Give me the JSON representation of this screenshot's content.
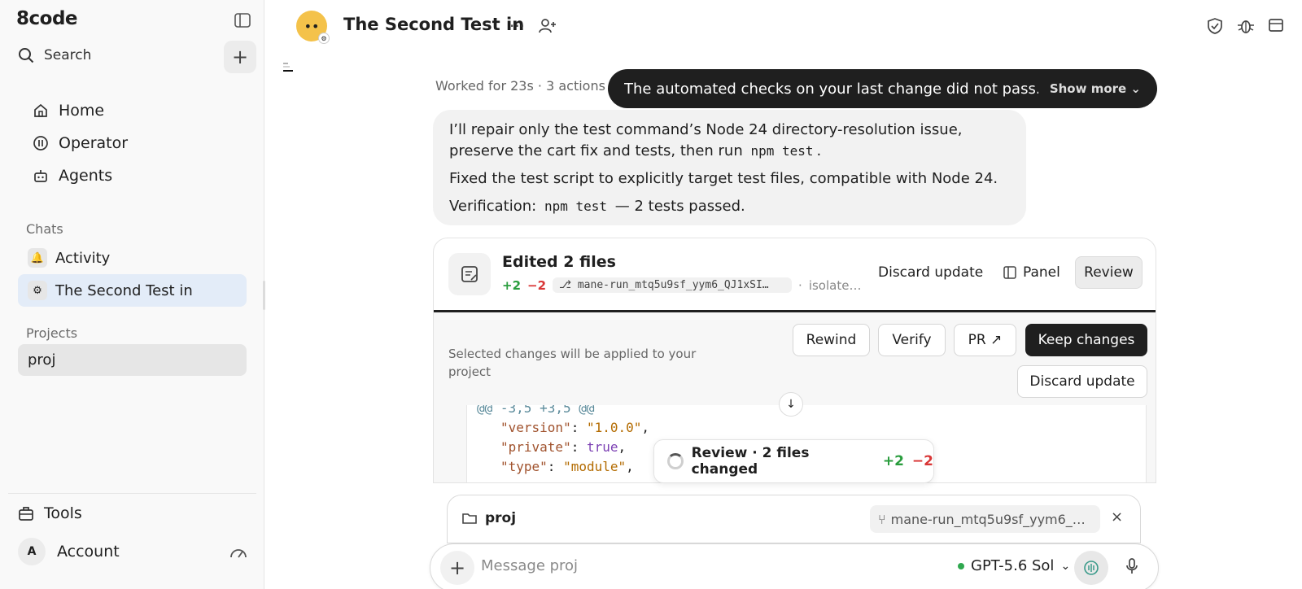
{
  "sidebar": {
    "logo": "8code",
    "search_label": "Search",
    "nav": [
      {
        "label": "Home",
        "icon": "home-icon"
      },
      {
        "label": "Operator",
        "icon": "operator-icon"
      },
      {
        "label": "Agents",
        "icon": "agents-icon"
      }
    ],
    "chats_label": "Chats",
    "chats": [
      {
        "label": "Activity",
        "icon": "bell-icon"
      },
      {
        "label": "The Second Test in",
        "icon": "openai-icon"
      }
    ],
    "projects_label": "Projects",
    "projects": [
      {
        "label": "proj"
      }
    ],
    "tools_label": "Tools",
    "account_label": "Account",
    "account_initial": "A"
  },
  "header": {
    "title": "The Second Test in",
    "dots": "···"
  },
  "status": {
    "worked": "Worked for 23s · 3 actions",
    "toast_text": "The automated checks on your last change did not pass. Fi..",
    "toast_more": "Show more"
  },
  "message": {
    "p1_before": "I’ll repair only the test command’s Node 24 directory-resolution issue, preserve the cart fix and tests, then run",
    "p1_code": "npm test",
    "p1_after": ".",
    "p2": "Fixed the test script to explicitly target test files, compatible with Node 24.",
    "p3_before": "Verification:",
    "p3_code": "npm test",
    "p3_after": "— 2 tests passed."
  },
  "card": {
    "title": "Edited 2 files",
    "plus": "+2",
    "minus": "−2",
    "branch": "⎇ mane-run_mtq5u9sf_yym6_QJ1xSI…",
    "sep": "·",
    "isolate": "isolate…",
    "discard_label": "Discard update",
    "panel_label": "Panel",
    "review_label": "Review",
    "selected_note": "Selected changes will be applied to your project",
    "actions": {
      "rewind": "Rewind",
      "verify": "Verify",
      "pr": "PR ↗",
      "keep": "Keep changes",
      "discard": "Discard update"
    },
    "diff": {
      "hunk": "@@ -3,5 +3,5 @@",
      "lines": [
        {
          "key": "\"version\"",
          "colon": ": ",
          "val": "\"1.0.0\"",
          "tail": ","
        },
        {
          "key": "\"private\"",
          "colon": ": ",
          "val": "true",
          "tail": ","
        },
        {
          "key": "\"type\"",
          "colon": ": ",
          "val": "\"module\"",
          "tail": ","
        }
      ]
    }
  },
  "review_pill": {
    "label": "Review · 2 files changed",
    "plus": "+2",
    "minus": "−2"
  },
  "composer": {
    "folder": "proj",
    "branch": "mane-run_mtq5u9sf_yym6_…",
    "close": "×",
    "placeholder": "Message proj",
    "model": "GPT-5.6 Sol",
    "plus": "+"
  }
}
